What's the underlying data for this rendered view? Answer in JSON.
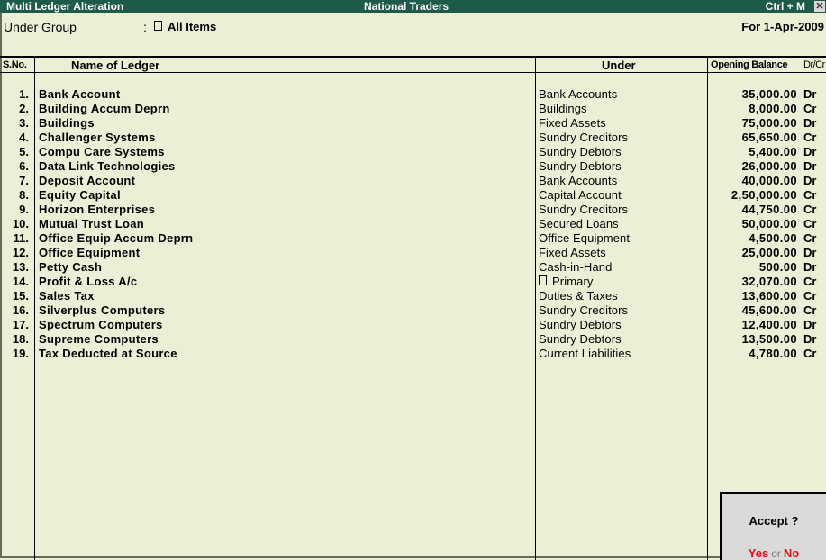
{
  "window": {
    "title": "Multi Ledger  Alteration",
    "company": "National Traders",
    "shortcut": "Ctrl + M",
    "close_glyph": "✕"
  },
  "filter": {
    "label": "Under Group",
    "colon": ":",
    "value": "All Items",
    "period": "For 1-Apr-2009"
  },
  "table": {
    "headers": {
      "sno": "S.No.",
      "name": "Name of Ledger",
      "under": "Under",
      "opening_balance": "Opening Balance",
      "drcr": "Dr/Cr"
    },
    "rows": [
      {
        "sno": "1.",
        "name": "Bank Account",
        "under": "Bank Accounts",
        "amount": "35,000.00",
        "drcr": "Dr"
      },
      {
        "sno": "2.",
        "name": "Building Accum Deprn",
        "under": "Buildings",
        "amount": "8,000.00",
        "drcr": "Cr"
      },
      {
        "sno": "3.",
        "name": "Buildings",
        "under": "Fixed Assets",
        "amount": "75,000.00",
        "drcr": "Dr"
      },
      {
        "sno": "4.",
        "name": "Challenger Systems",
        "under": "Sundry Creditors",
        "amount": "65,650.00",
        "drcr": "Cr"
      },
      {
        "sno": "5.",
        "name": "Compu Care Systems",
        "under": "Sundry Debtors",
        "amount": "5,400.00",
        "drcr": "Dr"
      },
      {
        "sno": "6.",
        "name": "Data Link Technologies",
        "under": "Sundry Debtors",
        "amount": "26,000.00",
        "drcr": "Dr"
      },
      {
        "sno": "7.",
        "name": "Deposit Account",
        "under": "Bank Accounts",
        "amount": "40,000.00",
        "drcr": "Dr"
      },
      {
        "sno": "8.",
        "name": "Equity Capital",
        "under": "Capital Account",
        "amount": "2,50,000.00",
        "drcr": "Cr"
      },
      {
        "sno": "9.",
        "name": "Horizon Enterprises",
        "under": "Sundry Creditors",
        "amount": "44,750.00",
        "drcr": "Cr"
      },
      {
        "sno": "10.",
        "name": "Mutual Trust Loan",
        "under": "Secured Loans",
        "amount": "50,000.00",
        "drcr": "Cr"
      },
      {
        "sno": "11.",
        "name": "Office Equip Accum Deprn",
        "under": "Office Equipment",
        "amount": "4,500.00",
        "drcr": "Cr"
      },
      {
        "sno": "12.",
        "name": "Office Equipment",
        "under": "Fixed Assets",
        "amount": "25,000.00",
        "drcr": "Dr"
      },
      {
        "sno": "13.",
        "name": "Petty Cash",
        "under": "Cash-in-Hand",
        "amount": "500.00",
        "drcr": "Dr"
      },
      {
        "sno": "14.",
        "name": "Profit & Loss A/c",
        "under": "Primary",
        "under_box": true,
        "amount": "32,070.00",
        "drcr": "Cr"
      },
      {
        "sno": "15.",
        "name": "Sales Tax",
        "under": "Duties & Taxes",
        "amount": "13,600.00",
        "drcr": "Cr"
      },
      {
        "sno": "16.",
        "name": "Silverplus Computers",
        "under": "Sundry Creditors",
        "amount": "45,600.00",
        "drcr": "Cr"
      },
      {
        "sno": "17.",
        "name": "Spectrum Computers",
        "under": "Sundry Debtors",
        "amount": "12,400.00",
        "drcr": "Dr"
      },
      {
        "sno": "18.",
        "name": "Supreme Computers",
        "under": "Sundry Debtors",
        "amount": "13,500.00",
        "drcr": "Dr"
      },
      {
        "sno": "19.",
        "name": "Tax Deducted at Source",
        "under": "Current Liabilities",
        "amount": "4,780.00",
        "drcr": "Cr"
      }
    ]
  },
  "dialog": {
    "question": "Accept ?",
    "yes": "Yes",
    "or": "or",
    "no": "No",
    "accent": "#e01010"
  },
  "colors": {
    "titlebar": "#1d5a4a",
    "background": "#ecefd5",
    "dialog": "#d9d9d9"
  }
}
